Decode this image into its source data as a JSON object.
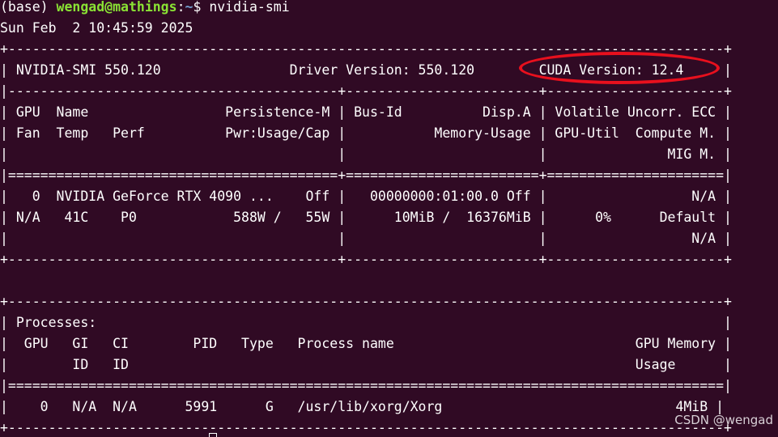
{
  "prompt": {
    "env": "(base) ",
    "user_host": "wengad@mathings",
    "separator": ":",
    "path": "~",
    "dollar": "$ ",
    "command": "nvidia-smi"
  },
  "date_line": "Sun Feb  2 10:45:59 2025",
  "lines": [
    "+-----------------------------------------------------------------------------------------+",
    "| NVIDIA-SMI 550.120                Driver Version: 550.120        CUDA Version: 12.4     |",
    "|-----------------------------------------+------------------------+----------------------+",
    "| GPU  Name                 Persistence-M | Bus-Id          Disp.A | Volatile Uncorr. ECC |",
    "| Fan  Temp   Perf          Pwr:Usage/Cap |           Memory-Usage | GPU-Util  Compute M. |",
    "|                                         |                        |               MIG M. |",
    "|=========================================+========================+======================|",
    "|   0  NVIDIA GeForce RTX 4090 ...    Off |   00000000:01:00.0 Off |                  N/A |",
    "| N/A   41C    P0            588W /   55W |      10MiB /  16376MiB |      0%      Default |",
    "|                                         |                        |                  N/A |",
    "+-----------------------------------------+------------------------+----------------------+",
    "",
    "",
    "+-----------------------------------------------------------------------------------------+",
    "| Processes:                                                                              |",
    "|  GPU   GI   CI        PID   Type   Process name                              GPU Memory |",
    "|        ID   ID                                                               Usage      |",
    "|=========================================================================================|",
    "|    0   N/A  N/A      5991      G   /usr/lib/xorg/Xorg                             4MiB |",
    "+-----------------------------------------------------------------------------------------+"
  ],
  "watermark": "CSDN @wengad",
  "colors": {
    "background": "#300a24",
    "text": "#ffffff",
    "user_host": "#8ae234",
    "path": "#729fcf",
    "highlight_ellipse": "#e8101d"
  }
}
